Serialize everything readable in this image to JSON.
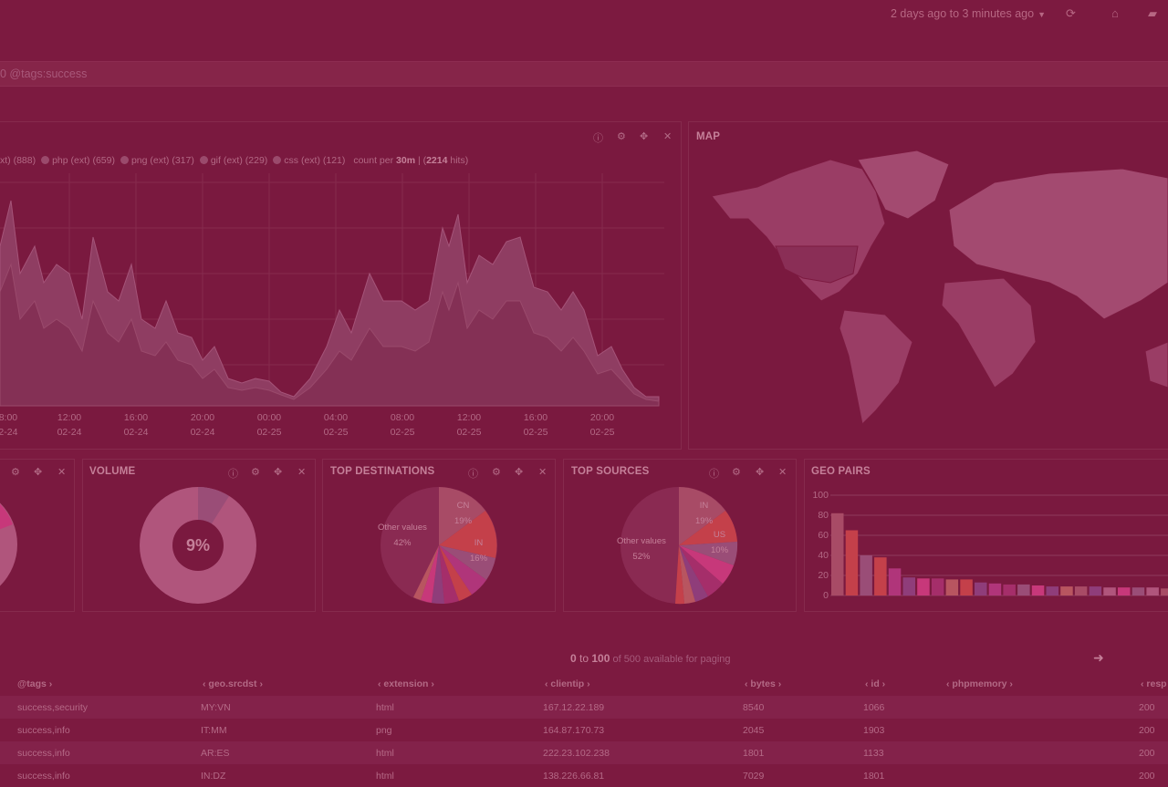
{
  "topbar": {
    "timerange": "2 days ago to 3 minutes ago",
    "caret_icon": "caret-down-icon",
    "refresh_icon": "refresh-icon",
    "home_icon": "home-icon",
    "folder_icon": "folder-open-icon"
  },
  "query": {
    "text": "0 @tags:success"
  },
  "histogram": {
    "legend": [
      {
        "label": "xt) (888)"
      },
      {
        "label": "php (ext) (659)"
      },
      {
        "label": "png (ext) (317)"
      },
      {
        "label": "gif (ext) (229)"
      },
      {
        "label": "css (ext) (121)"
      }
    ],
    "count_per_prefix": "count per ",
    "interval": "30m",
    "sep": " | (",
    "hits_total": "2214",
    "hits_suffix": " hits)",
    "ticks": [
      {
        "time": "08:00",
        "date": "02-24"
      },
      {
        "time": "12:00",
        "date": "02-24"
      },
      {
        "time": "16:00",
        "date": "02-24"
      },
      {
        "time": "20:00",
        "date": "02-24"
      },
      {
        "time": "00:00",
        "date": "02-25"
      },
      {
        "time": "04:00",
        "date": "02-25"
      },
      {
        "time": "08:00",
        "date": "02-25"
      },
      {
        "time": "12:00",
        "date": "02-25"
      },
      {
        "time": "16:00",
        "date": "02-25"
      },
      {
        "time": "20:00",
        "date": "02-25"
      }
    ]
  },
  "map": {
    "title": "MAP"
  },
  "volume": {
    "title": "VOLUME",
    "value_label": "9%"
  },
  "top_destinations": {
    "title": "TOP DESTINATIONS",
    "labels": [
      {
        "name": "CN",
        "pct": "19%"
      },
      {
        "name": "IN",
        "pct": "16%"
      },
      {
        "name": "Other values",
        "pct": "42%"
      }
    ]
  },
  "top_sources": {
    "title": "TOP SOURCES",
    "labels": [
      {
        "name": "IN",
        "pct": "19%"
      },
      {
        "name": "US",
        "pct": "10%"
      },
      {
        "name": "Other values",
        "pct": "52%"
      }
    ]
  },
  "geo_pairs": {
    "title": "GEO PAIRS",
    "yticks": [
      "100",
      "80",
      "60",
      "40",
      "20",
      "0"
    ]
  },
  "chart_data": [
    {
      "type": "area",
      "title": "",
      "series": [
        {
          "name": "xt) (888)",
          "values": [
            40,
            75,
            90,
            60,
            45,
            50,
            70,
            55,
            45,
            35,
            30,
            20,
            12,
            10,
            8,
            12,
            20,
            35,
            50,
            55,
            60,
            75,
            80,
            70,
            60,
            45,
            35,
            30,
            20,
            10
          ]
        },
        {
          "name": "php (ext) (659)",
          "values": [
            30,
            55,
            65,
            45,
            35,
            38,
            50,
            40,
            33,
            26,
            22,
            16,
            10,
            8,
            6,
            10,
            15,
            26,
            38,
            42,
            46,
            58,
            60,
            52,
            44,
            34,
            26,
            22,
            15,
            8
          ]
        }
      ]
    },
    {
      "type": "pie",
      "title": "VOLUME",
      "slices": [
        {
          "label": "9%",
          "value": 9
        },
        {
          "label": "",
          "value": 91
        }
      ]
    },
    {
      "type": "pie",
      "title": "TOP DESTINATIONS",
      "slices": [
        {
          "label": "CN",
          "value": 19
        },
        {
          "label": "IN",
          "value": 16
        },
        {
          "label": "",
          "value": 23
        },
        {
          "label": "Other values",
          "value": 42
        }
      ]
    },
    {
      "type": "pie",
      "title": "TOP SOURCES",
      "slices": [
        {
          "label": "IN",
          "value": 19
        },
        {
          "label": "US",
          "value": 10
        },
        {
          "label": "",
          "value": 19
        },
        {
          "label": "Other values",
          "value": 52
        }
      ]
    },
    {
      "type": "bar",
      "title": "GEO PAIRS",
      "ylim": [
        0,
        100
      ],
      "values": [
        82,
        65,
        40,
        38,
        27,
        18,
        17,
        17,
        16,
        16,
        13,
        12,
        11,
        11,
        10,
        9,
        9,
        9,
        9,
        8,
        8,
        8,
        8,
        7,
        7,
        7,
        7
      ]
    }
  ],
  "table": {
    "paging_from": "0",
    "paging_to_word": " to ",
    "paging_to": "100",
    "paging_rest": " of 500 available for paging",
    "next_icon": "arrow-right-icon",
    "headers": [
      "@tags",
      "geo.srcdst",
      "extension",
      "clientip",
      "bytes",
      "id",
      "phpmemory",
      "resp"
    ],
    "rows": [
      [
        "success,security",
        "MY:VN",
        "html",
        "167.12.22.189",
        "8540",
        "1066",
        "",
        "200"
      ],
      [
        "success,info",
        "IT:MM",
        "png",
        "164.87.170.73",
        "2045",
        "1903",
        "",
        "200"
      ],
      [
        "success,info",
        "AR:ES",
        "html",
        "222.23.102.238",
        "1801",
        "1133",
        "",
        "200"
      ],
      [
        "success,info",
        "IN:DZ",
        "html",
        "138.226.66.81",
        "7029",
        "1801",
        "",
        "200"
      ]
    ]
  },
  "colors": {
    "background": "#7c1a40",
    "accent_red": "#c4404a",
    "accent_pink": "#b0557c"
  }
}
